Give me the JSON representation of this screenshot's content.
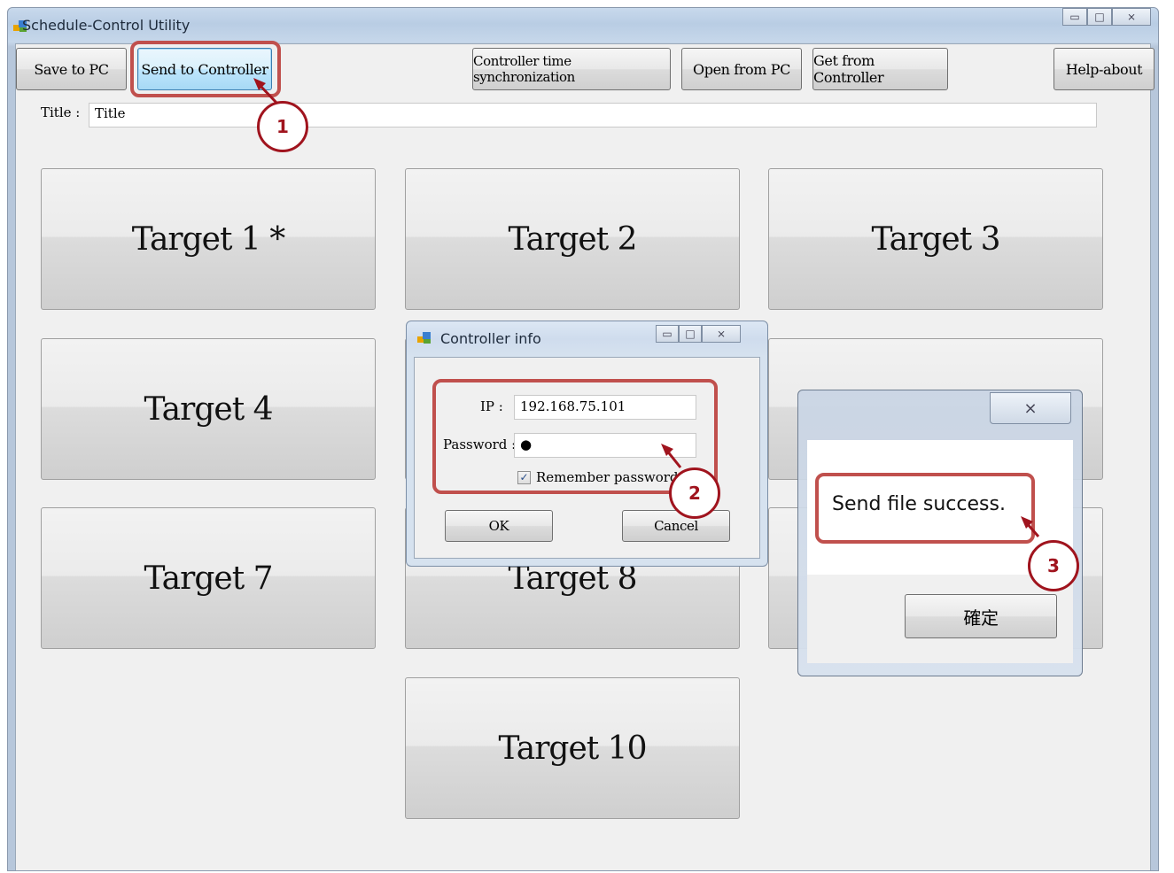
{
  "window": {
    "title": "Schedule-Control Utility",
    "minimize": "▭",
    "maximize": "□",
    "close": "⨯"
  },
  "toolbar": {
    "save_to_pc": "Save to PC",
    "send_to_controller": "Send to Controller",
    "time_sync": "Controller time synchronization",
    "open_from_pc": "Open from PC",
    "get_from_controller": "Get from Controller",
    "help_about": "Help-about"
  },
  "title_field": {
    "label": "Title :",
    "value": "Title"
  },
  "targets": [
    "Target 1 *",
    "Target 2",
    "Target 3",
    "Target 4",
    "Target 7",
    "Target 8",
    "Target 10"
  ],
  "controller_dialog": {
    "title": "Controller info",
    "ip_label": "IP :",
    "ip_value": "192.168.75.101",
    "password_label": "Password :",
    "password_value": "●",
    "remember_label": "Remember password",
    "remember_checked": true,
    "ok": "OK",
    "cancel": "Cancel"
  },
  "message_box": {
    "text": "Send file success.",
    "ok": "確定",
    "close": "⨯"
  },
  "callouts": [
    "1",
    "2",
    "3"
  ],
  "colors": {
    "highlight": "#c0504d",
    "callout": "#a0141e"
  }
}
